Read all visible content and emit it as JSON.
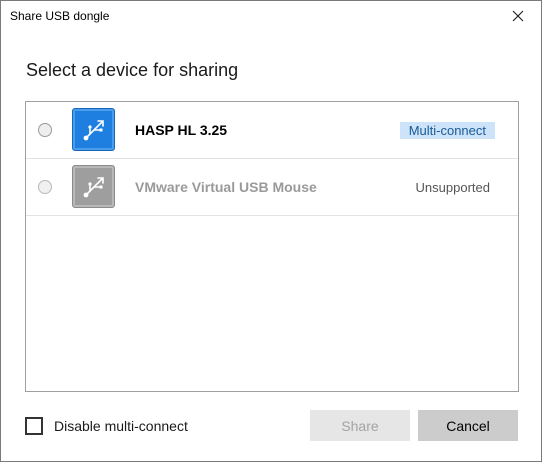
{
  "window": {
    "title": "Share USB dongle",
    "close_icon": "close-icon"
  },
  "heading": "Select a device for sharing",
  "devices": [
    {
      "name": "HASP HL 3.25",
      "icon": "usb-icon",
      "icon_color": "#1f7fe0",
      "status": "Multi-connect",
      "status_bg": "#cce3f9",
      "selected": false,
      "enabled": true
    },
    {
      "name": "VMware Virtual USB Mouse",
      "icon": "usb-icon",
      "icon_color": "#9e9e9e",
      "status": "Unsupported",
      "selected": false,
      "enabled": false
    }
  ],
  "options": {
    "disable_multi_connect_label": "Disable multi-connect",
    "disable_multi_connect_checked": false
  },
  "buttons": {
    "share": "Share",
    "cancel": "Cancel",
    "share_enabled": false
  }
}
